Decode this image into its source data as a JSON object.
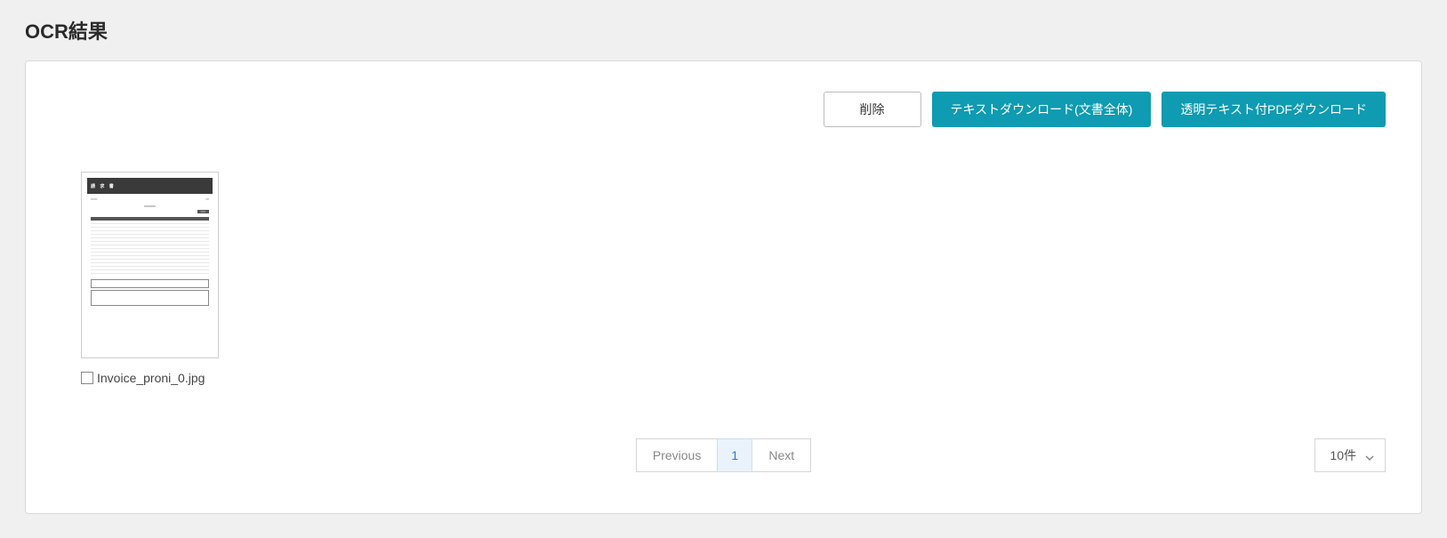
{
  "header": {
    "title": "OCR結果"
  },
  "toolbar": {
    "delete_label": "削除",
    "text_download_label": "テキストダウンロード(文書全体)",
    "pdf_download_label": "透明テキスト付PDFダウンロード"
  },
  "thumbnails": [
    {
      "filename": "Invoice_proni_0.jpg",
      "checked": false,
      "doc_title": "請 求 書"
    }
  ],
  "pagination": {
    "previous_label": "Previous",
    "next_label": "Next",
    "pages": [
      "1"
    ],
    "active_index": 0,
    "per_page_label": "10件"
  }
}
